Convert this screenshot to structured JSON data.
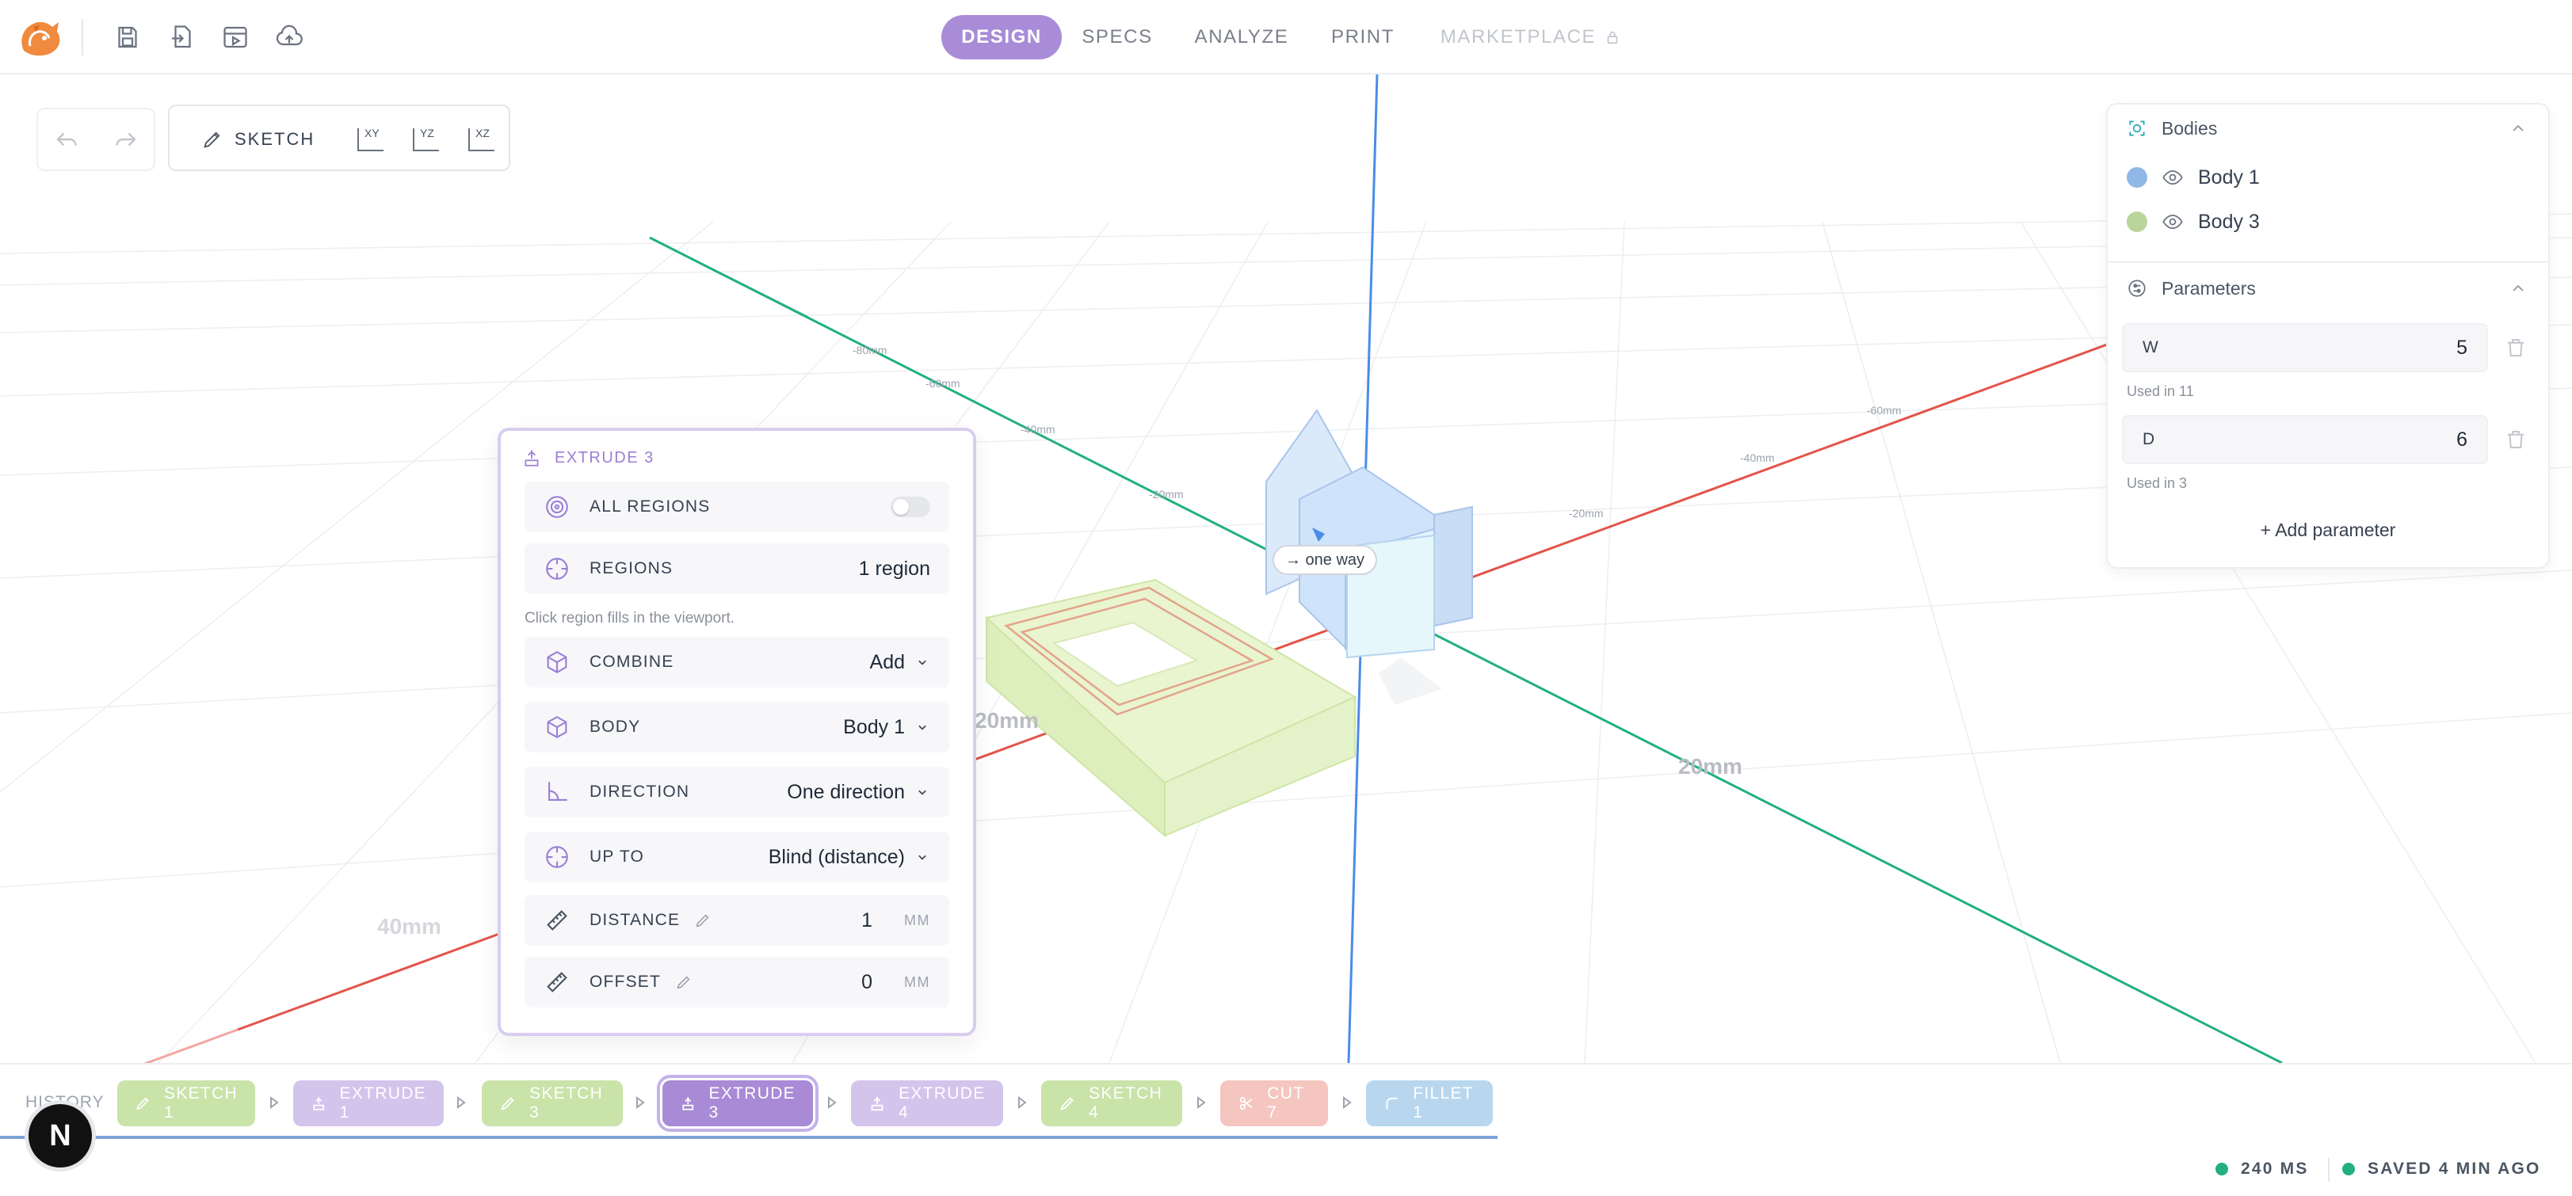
{
  "topbar": {
    "nav": [
      {
        "label": "DESIGN",
        "active": true
      },
      {
        "label": "SPECS"
      },
      {
        "label": "ANALYZE"
      },
      {
        "label": "PRINT"
      },
      {
        "label": "MARKETPLACE",
        "locked": true
      }
    ],
    "icons": [
      "save-icon",
      "import-icon",
      "play-icon",
      "cloud-upload-icon"
    ]
  },
  "toolbar": {
    "sketch_label": "SKETCH",
    "planes": [
      "XY",
      "YZ",
      "XZ"
    ]
  },
  "viewport": {
    "axis_labels": [
      "20mm",
      "20mm",
      "40mm"
    ],
    "ticks": [
      "-20mm",
      "-40mm",
      "-60mm",
      "-80mm",
      "-20mm",
      "-40mm",
      "-60mm"
    ],
    "direction_tag": "→ one way"
  },
  "extrude": {
    "title": "EXTRUDE 3",
    "all_regions_label": "ALL REGIONS",
    "regions_label": "REGIONS",
    "regions_value": "1 region",
    "hint": "Click region fills in the viewport.",
    "combine_label": "COMBINE",
    "combine_value": "Add",
    "body_label": "BODY",
    "body_value": "Body 1",
    "direction_label": "DIRECTION",
    "direction_value": "One direction",
    "upto_label": "UP TO",
    "upto_value": "Blind (distance)",
    "distance_label": "DISTANCE",
    "distance_value": "1",
    "distance_unit": "MM",
    "offset_label": "OFFSET",
    "offset_value": "0",
    "offset_unit": "MM"
  },
  "panel": {
    "bodies_title": "Bodies",
    "bodies": [
      {
        "name": "Body 1",
        "color": "#8fb8e6"
      },
      {
        "name": "Body 3",
        "color": "#b9d59a"
      }
    ],
    "params_title": "Parameters",
    "params": [
      {
        "name": "W",
        "value": "5",
        "used": "Used in 11"
      },
      {
        "name": "D",
        "value": "6",
        "used": "Used in 3"
      }
    ],
    "add_label": "+ Add parameter"
  },
  "history": {
    "label": "HISTORY",
    "items": [
      {
        "label": "SKETCH 1",
        "color": "#c9e3a9"
      },
      {
        "label": "EXTRUDE 1",
        "color": "#d3c4ec"
      },
      {
        "label": "SKETCH 3",
        "color": "#c9e3a9"
      },
      {
        "label": "EXTRUDE 3",
        "color": "#a88ad6",
        "active": true
      },
      {
        "label": "EXTRUDE 4",
        "color": "#d3c4ec"
      },
      {
        "label": "SKETCH 4",
        "color": "#c9e3a9"
      },
      {
        "label": "CUT 7",
        "color": "#f5c6c0"
      },
      {
        "label": "FILLET 1",
        "color": "#b8d7ef"
      }
    ]
  },
  "status": {
    "timing": "240 MS",
    "saved": "SAVED 4 MIN AGO",
    "badge": "N"
  }
}
